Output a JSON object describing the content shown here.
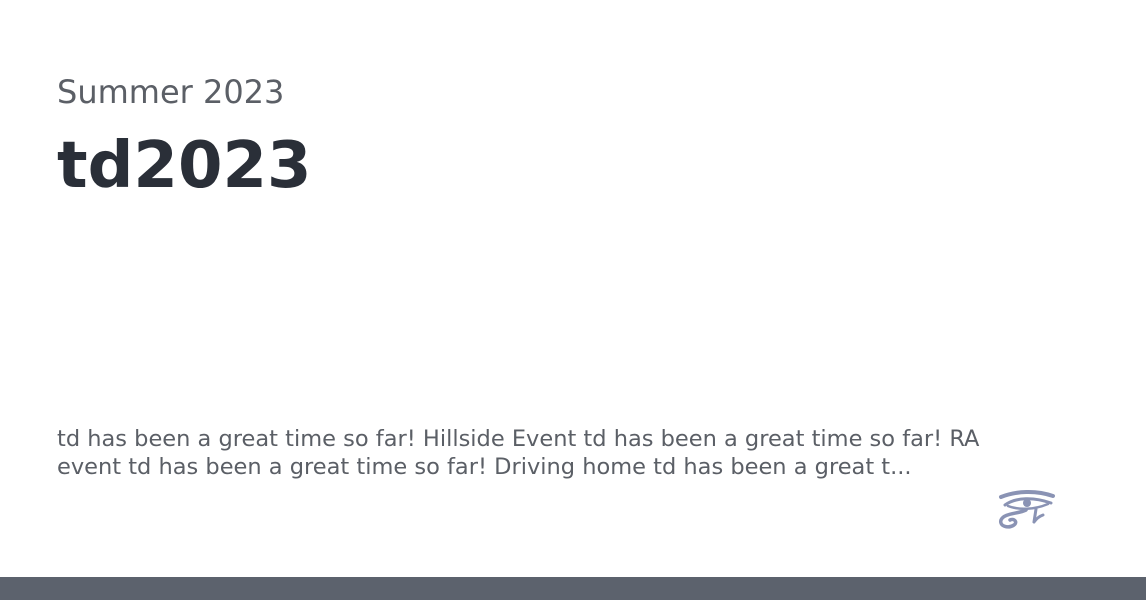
{
  "card": {
    "subtitle": "Summer 2023",
    "title": "td2023",
    "description": "td has been a great time so far! Hillside Event td has been a great time so far! RA event td has been a great time so far! Driving home td has been a great t...",
    "logo_icon": "eye-of-horus-icon",
    "colors": {
      "subtitle": "#5b5f66",
      "title": "#2a2f38",
      "logo": "#8a93b4",
      "footer_bar": "#5c626d"
    }
  }
}
